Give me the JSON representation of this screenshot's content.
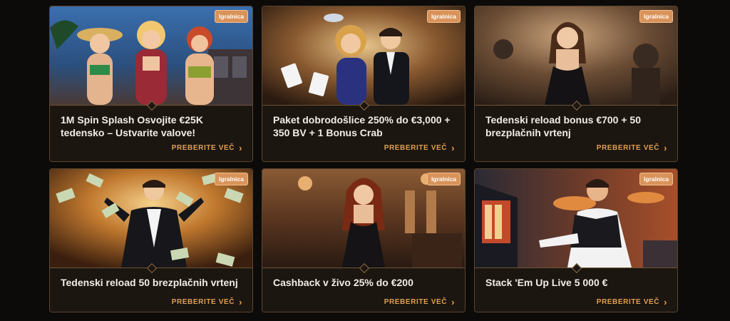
{
  "promotions": [
    {
      "badge": "Igralnica",
      "title": "1M Spin Splash Osvojite €25K tedensko – Ustvarite valove!",
      "cta": "PREBERITE VEČ"
    },
    {
      "badge": "Igralnica",
      "title": "Paket dobrodošlice 250% do €3,000 + 350 BV + 1 Bonus Crab",
      "cta": "PREBERITE VEČ"
    },
    {
      "badge": "Igralnica",
      "title": "Tedenski reload bonus €700 + 50 brezplačnih vrtenj",
      "cta": "PREBERITE VEČ"
    },
    {
      "badge": "Igralnica",
      "title": "Tedenski reload 50 brezplačnih vrtenj",
      "cta": "PREBERITE VEČ"
    },
    {
      "badge": "Igralnica",
      "title": "Cashback v živo 25% do €200",
      "cta": "PREBERITE VEČ"
    },
    {
      "badge": "Igralnica",
      "title": "Stack 'Em Up Live 5 000 €",
      "cta": "PREBERITE VEČ"
    }
  ],
  "colors": {
    "background": "#0d0b09",
    "card": "#1c1611",
    "border": "#5a4630",
    "accent": "#e0a050",
    "badge": "#d9935a"
  },
  "icons": {
    "cta": "chevron-right-icon"
  }
}
